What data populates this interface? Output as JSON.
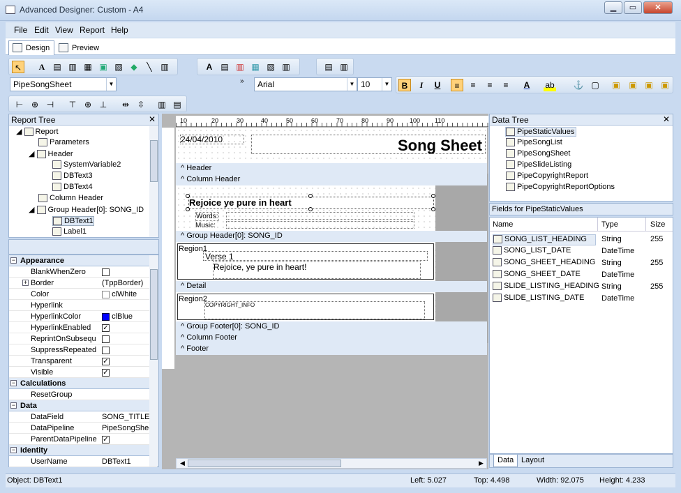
{
  "window": {
    "title": "Advanced Designer: Custom - A4"
  },
  "menus": [
    "File",
    "Edit",
    "View",
    "Report",
    "Help"
  ],
  "tabs": [
    {
      "label": "Design"
    },
    {
      "label": "Preview"
    }
  ],
  "toolbar": {
    "pipeline_select": "PipeSongSheet",
    "font_name": "Arial",
    "font_size": "10",
    "bold": "B",
    "italic": "I",
    "underline": "U"
  },
  "report_tree": {
    "title": "Report Tree",
    "items": [
      "Report",
      "Parameters",
      "Header",
      "SystemVariable2",
      "DBText3",
      "DBText4",
      "Column Header",
      "Group Header[0]: SONG_ID",
      "DBText1",
      "Label1"
    ]
  },
  "properties": {
    "appearance": {
      "label": "Appearance",
      "rows": [
        {
          "name": "BlankWhenZero",
          "value": ""
        },
        {
          "name": "Border",
          "value": "(TppBorder)"
        },
        {
          "name": "Color",
          "value": "clWhite"
        },
        {
          "name": "Hyperlink",
          "value": ""
        },
        {
          "name": "HyperlinkColor",
          "value": "clBlue"
        },
        {
          "name": "HyperlinkEnabled",
          "value": ""
        },
        {
          "name": "ReprintOnSubsequ",
          "value": ""
        },
        {
          "name": "SuppressRepeated",
          "value": ""
        },
        {
          "name": "Transparent",
          "value": ""
        },
        {
          "name": "Visible",
          "value": ""
        }
      ]
    },
    "calculations": {
      "label": "Calculations",
      "rows": [
        {
          "name": "ResetGroup",
          "value": ""
        }
      ]
    },
    "data": {
      "label": "Data",
      "rows": [
        {
          "name": "DataField",
          "value": "SONG_TITLE"
        },
        {
          "name": "DataPipeline",
          "value": "PipeSongSheet"
        },
        {
          "name": "ParentDataPipeline",
          "value": ""
        }
      ]
    },
    "identity": {
      "label": "Identity",
      "rows": [
        {
          "name": "UserName",
          "value": "DBText1"
        }
      ]
    }
  },
  "ruler": {
    "labels": [
      "10",
      "20",
      "30",
      "40",
      "50",
      "60",
      "70",
      "80",
      "90",
      "100",
      "110"
    ]
  },
  "canvas": {
    "date_text": "24/04/2010",
    "song_sheet_title": "Song Sheet",
    "bands": {
      "header": "Header",
      "column_header": "Column Header",
      "group_header": "Group Header[0]: SONG_ID",
      "detail": "Detail",
      "group_footer": "Group Footer[0]: SONG_ID",
      "column_footer": "Column Footer",
      "footer": "Footer"
    },
    "song_title": "Rejoice ye pure in heart",
    "words_label": "Words:",
    "music_label": "Music:",
    "region1": "Region1",
    "verse_label": "Verse 1",
    "verse_text": "Rejoice, ye pure in heart!",
    "region2": "Region2",
    "copyright": "COPYRIGHT_INFO"
  },
  "data_tree": {
    "title": "Data Tree",
    "pipelines": [
      "PipeStaticValues",
      "PipeSongList",
      "PipeSongSheet",
      "PipeSlideListing",
      "PipeCopyrightReport",
      "PipeCopyrightReportOptions"
    ]
  },
  "fields": {
    "title": "Fields for PipeStaticValues",
    "columns": [
      "Name",
      "Type",
      "Size"
    ],
    "rows": [
      {
        "name": "SONG_LIST_HEADING",
        "type": "String",
        "size": "255"
      },
      {
        "name": "SONG_LIST_DATE",
        "type": "DateTime",
        "size": ""
      },
      {
        "name": "SONG_SHEET_HEADING",
        "type": "String",
        "size": "255"
      },
      {
        "name": "SONG_SHEET_DATE",
        "type": "DateTime",
        "size": ""
      },
      {
        "name": "SLIDE_LISTING_HEADING",
        "type": "String",
        "size": "255"
      },
      {
        "name": "SLIDE_LISTING_DATE",
        "type": "DateTime",
        "size": ""
      }
    ]
  },
  "bottom_tabs": [
    "Data",
    "Layout"
  ],
  "status": {
    "object": "Object: DBText1",
    "left": "Left: 5.027",
    "top": "Top: 4.498",
    "width": "Width: 92.075",
    "height": "Height: 4.233"
  }
}
